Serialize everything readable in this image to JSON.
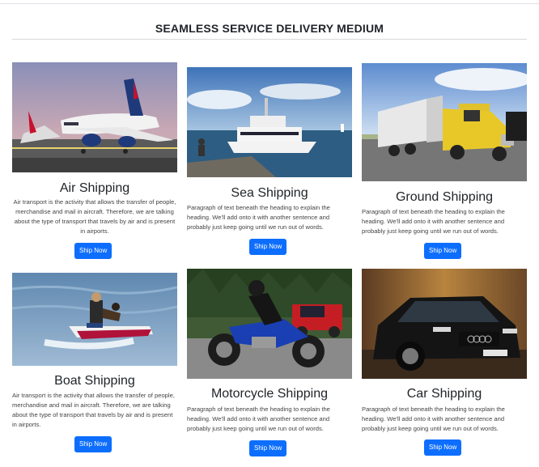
{
  "section": {
    "title": "SEAMLESS SERVICE DELIVERY MEDIUM"
  },
  "cards": [
    {
      "title": "Air Shipping",
      "text": "Air transport is the activity that allows the transfer of people, merchandise and mail in aircraft. Therefore, we are talking about the type of transport that travels by air and is present in airports.",
      "button": "Ship Now",
      "image": "airplane-photo"
    },
    {
      "title": "Sea Shipping",
      "text": "Paragraph of text beneath the heading to explain the heading. We'll add onto it with another sentence and probably just keep going until we run out of words.",
      "button": "Ship Now",
      "image": "ship-photo"
    },
    {
      "title": "Ground Shipping",
      "text": "Paragraph of text beneath the heading to explain the heading. We'll add onto it with another sentence and probably just keep going until we run out of words.",
      "button": "Ship Now",
      "image": "truck-photo"
    },
    {
      "title": "Boat Shipping",
      "text": "Air transport is the activity that allows the transfer of people, merchandise and mail in aircraft. Therefore, we are talking about the type of transport that travels by air and is present in airports.",
      "button": "Ship Now",
      "image": "jetski-photo"
    },
    {
      "title": "Motorcycle Shipping",
      "text": "Paragraph of text beneath the heading to explain the heading. We'll add onto it with another sentence and probably just keep going until we run out of words.",
      "button": "Ship Now",
      "image": "motorcycle-photo"
    },
    {
      "title": "Car Shipping",
      "text": "Paragraph of text beneath the heading to explain the heading. We'll add onto it with another sentence and probably just keep going until we run out of words.",
      "button": "Ship Now",
      "image": "car-photo"
    }
  ]
}
